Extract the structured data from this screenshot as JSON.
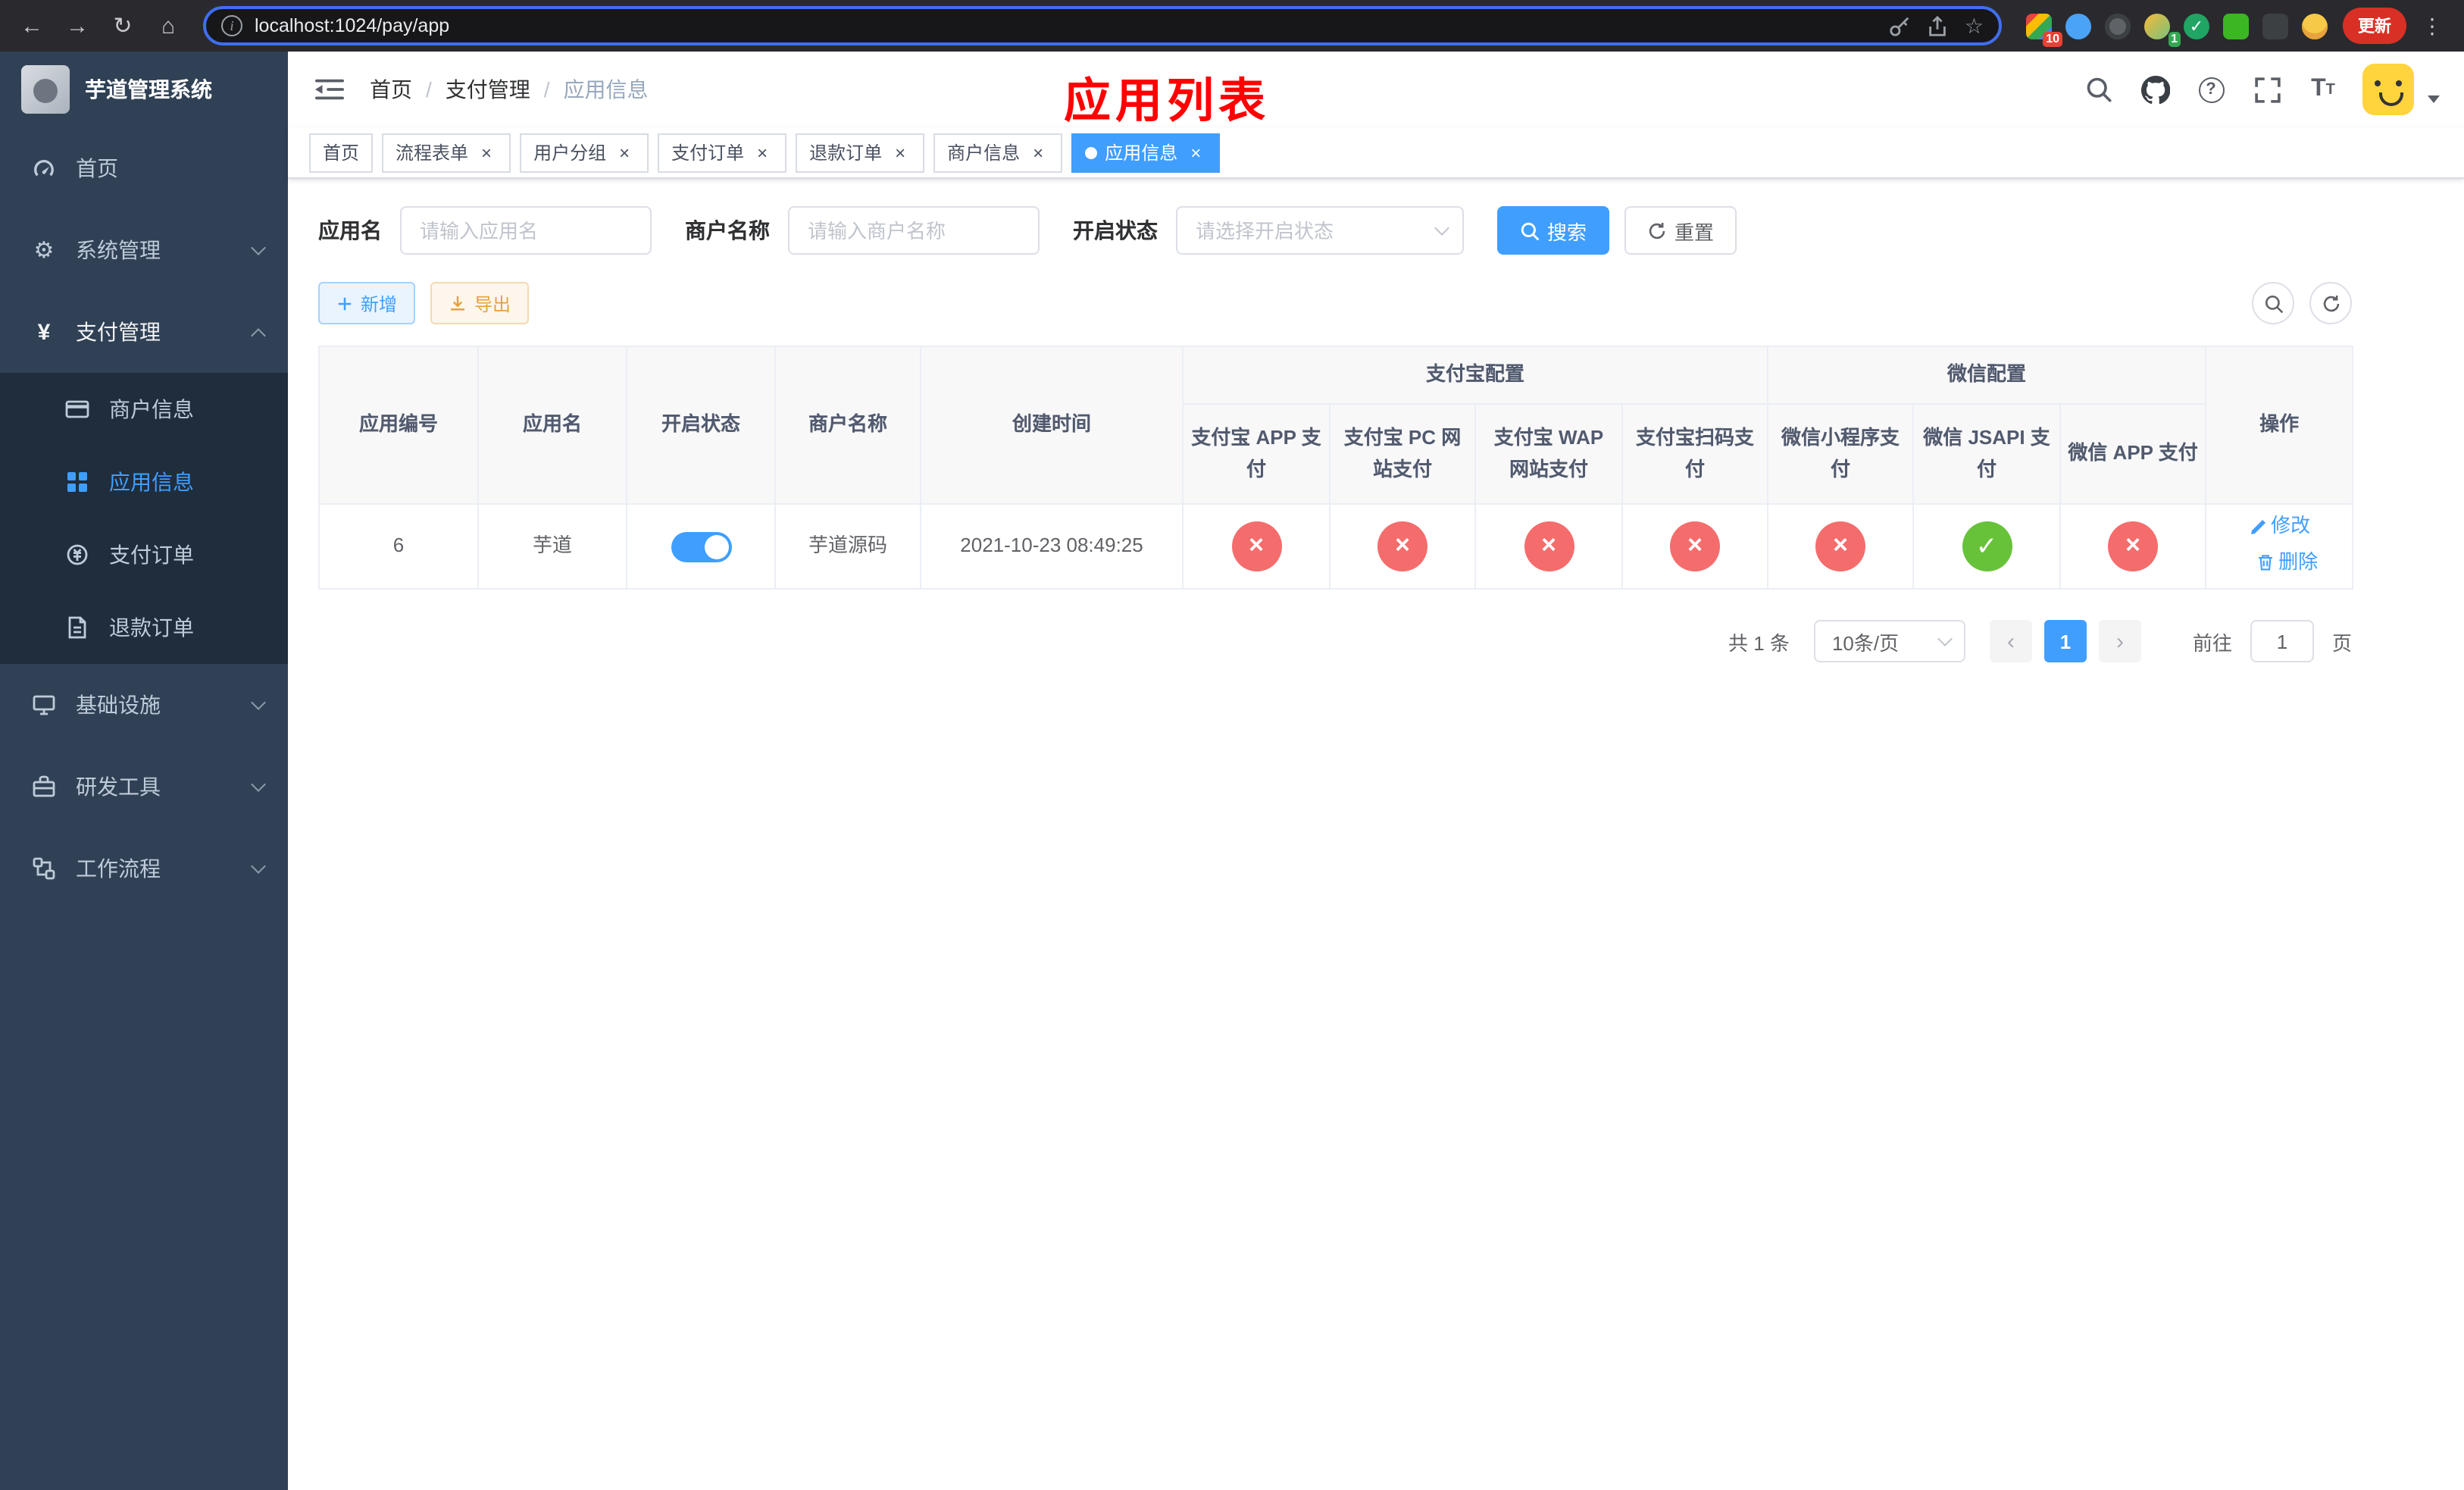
{
  "browser": {
    "url": "localhost:1024/pay/app",
    "update_label": "更新",
    "extension_badge_1": "10",
    "extension_badge_2": "1"
  },
  "sidebar": {
    "title": "芋道管理系统",
    "items": [
      {
        "label": "首页"
      },
      {
        "label": "系统管理"
      },
      {
        "label": "支付管理"
      },
      {
        "label": "基础设施"
      },
      {
        "label": "研发工具"
      },
      {
        "label": "工作流程"
      }
    ],
    "pay_children": [
      {
        "label": "商户信息"
      },
      {
        "label": "应用信息"
      },
      {
        "label": "支付订单"
      },
      {
        "label": "退款订单"
      }
    ]
  },
  "header": {
    "breadcrumb": [
      "首页",
      "支付管理",
      "应用信息"
    ],
    "annotation_title": "应用列表"
  },
  "tabs": [
    {
      "label": "首页"
    },
    {
      "label": "流程表单"
    },
    {
      "label": "用户分组"
    },
    {
      "label": "支付订单"
    },
    {
      "label": "退款订单"
    },
    {
      "label": "商户信息"
    },
    {
      "label": "应用信息"
    }
  ],
  "filters": {
    "app_name_label": "应用名",
    "app_name_placeholder": "请输入应用名",
    "merchant_label": "商户名称",
    "merchant_placeholder": "请输入商户名称",
    "status_label": "开启状态",
    "status_placeholder": "请选择开启状态",
    "search_label": "搜索",
    "reset_label": "重置"
  },
  "toolbar": {
    "add_label": "新增",
    "export_label": "导出"
  },
  "table": {
    "columns": {
      "app_id": "应用编号",
      "app_name": "应用名",
      "status": "开启状态",
      "merchant": "商户名称",
      "created": "创建时间",
      "alipay_group": "支付宝配置",
      "alipay_app": "支付宝 APP 支付",
      "alipay_pc": "支付宝 PC 网站支付",
      "alipay_wap": "支付宝 WAP 网站支付",
      "alipay_qr": "支付宝扫码支付",
      "wechat_group": "微信配置",
      "wechat_mini": "微信小程序支付",
      "wechat_jsapi": "微信 JSAPI 支付",
      "wechat_app": "微信 APP 支付",
      "actions": "操作"
    },
    "rows": [
      {
        "app_id": "6",
        "app_name": "芋道",
        "enabled": true,
        "merchant": "芋道源码",
        "created": "2021-10-23 08:49:25",
        "alipay_app": false,
        "alipay_pc": false,
        "alipay_wap": false,
        "alipay_qr": false,
        "wechat_mini": false,
        "wechat_jsapi": true,
        "wechat_app": false,
        "edit_label": "修改",
        "delete_label": "删除"
      }
    ]
  },
  "pagination": {
    "total_text": "共 1 条",
    "page_size_text": "10条/页",
    "current_page": "1",
    "goto_prefix": "前往",
    "goto_value": "1",
    "goto_suffix": "页"
  },
  "colors": {
    "accent": "#409EFF",
    "success": "#67C23A",
    "danger": "#F56C6C",
    "warning": "#E6A23C",
    "sidebar_bg": "#304156",
    "submenu_bg": "#1F2D3D",
    "annotation": "#FF0000"
  }
}
